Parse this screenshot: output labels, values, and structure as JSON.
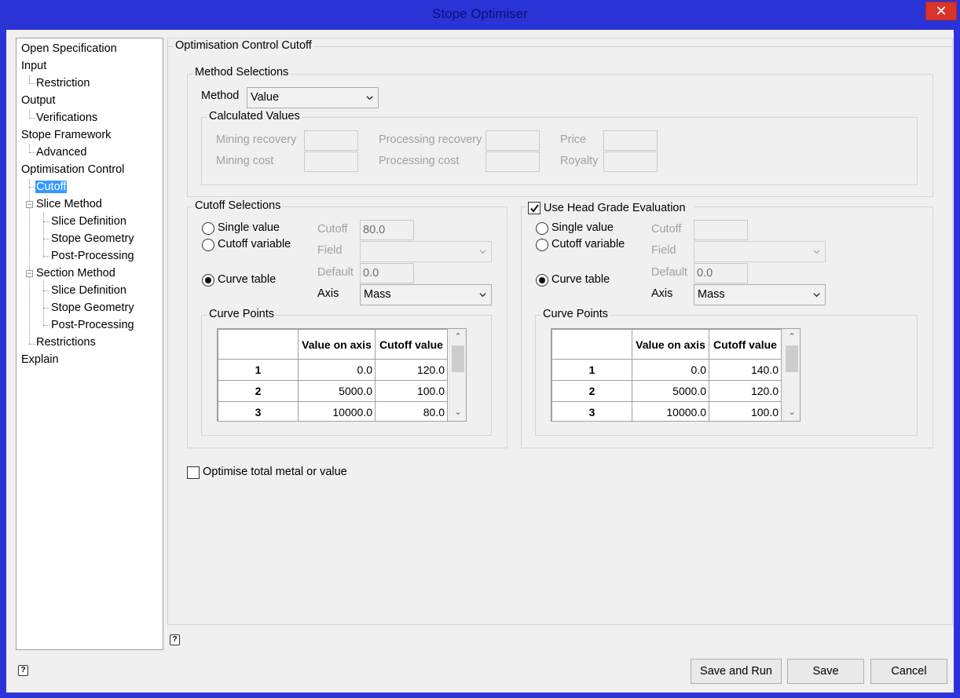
{
  "window": {
    "title": "Stope Optimiser",
    "close_glyph": "✕"
  },
  "tree": {
    "items": [
      {
        "label": "Open Specification"
      },
      {
        "label": "Input"
      },
      {
        "label": "Restriction"
      },
      {
        "label": "Output"
      },
      {
        "label": "Verifications"
      },
      {
        "label": "Stope Framework"
      },
      {
        "label": "Advanced"
      },
      {
        "label": "Optimisation Control"
      },
      {
        "label": "Cutoff"
      },
      {
        "label": "Slice Method"
      },
      {
        "label": "Slice Definition"
      },
      {
        "label": "Stope Geometry"
      },
      {
        "label": "Post-Processing"
      },
      {
        "label": "Section Method"
      },
      {
        "label": "Slice Definition"
      },
      {
        "label": "Stope Geometry"
      },
      {
        "label": "Post-Processing"
      },
      {
        "label": "Restrictions"
      },
      {
        "label": "Explain"
      }
    ],
    "selected": "Cutoff"
  },
  "panel": {
    "title": "Optimisation Control Cutoff",
    "method": {
      "group_label": "Method Selections",
      "label": "Method",
      "value": "Value"
    },
    "calculated": {
      "group_label": "Calculated Values",
      "mining_recovery": "Mining recovery",
      "mining_cost": "Mining cost",
      "processing_recovery": "Processing recovery",
      "processing_cost": "Processing cost",
      "price": "Price",
      "royalty": "Royalty"
    },
    "cutoff": {
      "group_label": "Cutoff Selections",
      "single_value": "Single value",
      "cutoff_variable": "Cutoff variable",
      "curve_table": "Curve table",
      "cutoff_label": "Cutoff",
      "cutoff_value": "80.0",
      "field_label": "Field",
      "default_label": "Default",
      "default_value": "0.0",
      "axis_label": "Axis",
      "axis_value": "Mass",
      "curve_points_label": "Curve Points",
      "table": {
        "headers": [
          "",
          "Value on axis",
          "Cutoff value"
        ],
        "rows": [
          [
            "1",
            "0.0",
            "120.0"
          ],
          [
            "2",
            "5000.0",
            "100.0"
          ],
          [
            "3",
            "10000.0",
            "80.0"
          ]
        ]
      }
    },
    "head_grade": {
      "checkbox_label": "Use Head Grade Evaluation",
      "checked": true,
      "single_value": "Single value",
      "cutoff_variable": "Cutoff variable",
      "curve_table": "Curve table",
      "cutoff_label": "Cutoff",
      "cutoff_value": "",
      "field_label": "Field",
      "default_label": "Default",
      "default_value": "0.0",
      "axis_label": "Axis",
      "axis_value": "Mass",
      "curve_points_label": "Curve Points",
      "table": {
        "headers": [
          "",
          "Value on axis",
          "Cutoff value"
        ],
        "rows": [
          [
            "1",
            "0.0",
            "140.0"
          ],
          [
            "2",
            "5000.0",
            "120.0"
          ],
          [
            "3",
            "10000.0",
            "100.0"
          ]
        ]
      }
    },
    "optimise_label": "Optimise total metal or value",
    "optimise_checked": false
  },
  "help_glyph": "?",
  "scroll_up_glyph": "⌃",
  "scroll_down_glyph": "⌄",
  "buttons": {
    "save_and_run": "Save and Run",
    "save": "Save",
    "cancel": "Cancel"
  }
}
